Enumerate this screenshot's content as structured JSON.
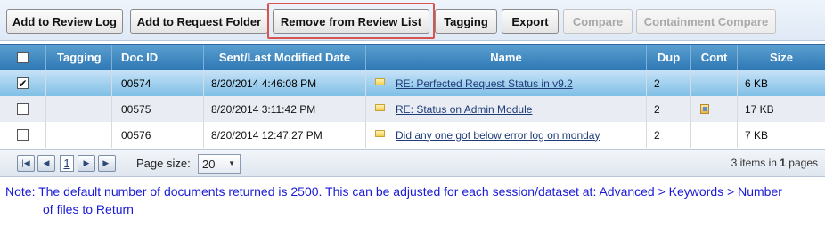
{
  "toolbar": {
    "buttons": [
      {
        "label": "Add to Review Log",
        "enabled": true
      },
      {
        "label": "Add to Request Folder",
        "enabled": true
      },
      {
        "label": "Remove from Review List",
        "enabled": true
      },
      {
        "label": "Tagging",
        "enabled": true
      },
      {
        "label": "Export",
        "enabled": true
      },
      {
        "label": "Compare",
        "enabled": false
      },
      {
        "label": "Containment Compare",
        "enabled": false
      }
    ],
    "highlight_color": "#d9534f"
  },
  "grid": {
    "columns": [
      "",
      "Tagging",
      "Doc ID",
      "Sent/Last Modified Date",
      "Name",
      "Dup",
      "Cont",
      "Size"
    ],
    "header_color": "#3a86c2",
    "rows": [
      {
        "checked": true,
        "tagging": "",
        "doc_id": "00574",
        "date": "8/20/2014 4:46:08 PM",
        "name": "RE: Perfected Request Status in v9.2",
        "name_icon": "email-icon",
        "dup": "2",
        "cont": "",
        "size": "6 KB"
      },
      {
        "checked": false,
        "tagging": "",
        "doc_id": "00575",
        "date": "8/20/2014 3:11:42 PM",
        "name": "RE: Status on Admin Module",
        "name_icon": "email-icon",
        "dup": "2",
        "cont": "attachment-icon",
        "size": "17 KB"
      },
      {
        "checked": false,
        "tagging": "",
        "doc_id": "00576",
        "date": "8/20/2014 12:47:27 PM",
        "name": "Did any one got below error log on monday",
        "name_icon": "email-icon",
        "dup": "2",
        "cont": "",
        "size": "7 KB"
      }
    ]
  },
  "pager": {
    "current_page": "1",
    "page_size_label": "Page size:",
    "page_size_value": "20",
    "items_info_prefix": "3 items in ",
    "items_info_pages": "1",
    "items_info_suffix": " pages"
  },
  "note": {
    "line1": "Note: The default number of documents returned is 2500. This can be adjusted for each session/dataset at: Advanced > Keywords > Number",
    "line2": "of files to Return"
  }
}
